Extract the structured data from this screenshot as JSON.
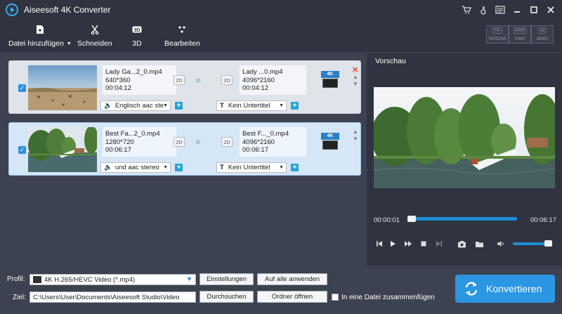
{
  "app": {
    "title": "Aiseesoft 4K Converter"
  },
  "window_controls": [
    "cart-icon",
    "key-icon",
    "menu-icon",
    "minimize-icon",
    "maximize-icon",
    "close-icon"
  ],
  "toolbar": {
    "add_file": "Datei hinzufügen",
    "cut": "Schneiden",
    "three_d": "3D",
    "edit": "Bearbeiten",
    "accel": [
      {
        "label": "NVIDIA",
        "chip": "nv"
      },
      {
        "label": "Intel",
        "chip": "intel"
      },
      {
        "label": "AMD",
        "chip": "a"
      }
    ]
  },
  "files": [
    {
      "src_name": "Lady Ga...2_0.mp4",
      "src_res": "640*360",
      "src_dur": "00:04:12",
      "src_badge": "2D",
      "dst_name": "Lady ...0.mp4",
      "dst_res": "4096*2160",
      "dst_dur": "00:04:12",
      "dst_badge": "2D",
      "format_badge": "4K",
      "audio": "Englisch aac ste",
      "subtitle": "Kein Untertitel",
      "checked": true,
      "selected": false
    },
    {
      "src_name": "Best Fa...2_0.mp4",
      "src_res": "1280*720",
      "src_dur": "00:06:17",
      "src_badge": "2D",
      "dst_name": "Best F..._0.mp4",
      "dst_res": "4096*2160",
      "dst_dur": "00:06:17",
      "dst_badge": "2D",
      "format_badge": "4K",
      "audio": "und aac stereo",
      "subtitle": "Kein Untertitel",
      "checked": true,
      "selected": true
    }
  ],
  "preview": {
    "title": "Vorschau",
    "current_time": "00:00:01",
    "total_time": "00:06:17",
    "progress": 0.03,
    "volume": 0.8
  },
  "bottom": {
    "profile_label": "Profil:",
    "profile_value": "4K H.265/HEVC Video (*.mp4)",
    "settings_button": "Einstellungen",
    "apply_all_button": "Auf alle anwenden",
    "target_label": "Ziel:",
    "target_path": "C:\\Users\\User\\Documents\\Aiseesoft Studio\\Video",
    "browse_button": "Durchsuchen",
    "open_folder_button": "Ordner öffnen",
    "merge_label": "In eine Datei zusammenfügen",
    "merge_checked": false,
    "convert_button": "Konvertieren"
  },
  "colors": {
    "accent": "#2b97e3",
    "delete": "#e04b2b",
    "panel": "#3c4250",
    "dark": "#2f3440"
  }
}
